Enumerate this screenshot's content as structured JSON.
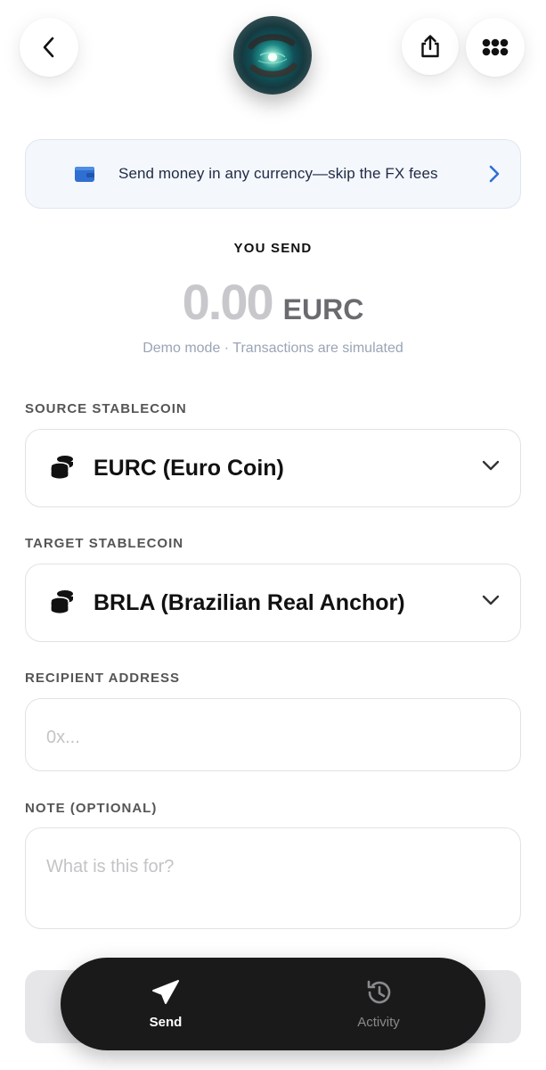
{
  "header": {
    "back_icon": "chevron-left-icon",
    "share_icon": "share-icon",
    "more_icon": "dots-grid-icon"
  },
  "banner": {
    "icon": "wallet-icon",
    "text": "Send money in any currency—skip the FX fees",
    "accent": "#2f6fd1"
  },
  "send": {
    "heading": "YOU SEND",
    "amount": "0.00",
    "currency": "EURC",
    "demo_note": "Demo mode · Transactions are simulated"
  },
  "form": {
    "source_label": "SOURCE STABLECOIN",
    "source_value": "EURC (Euro Coin)",
    "target_label": "TARGET STABLECOIN",
    "target_value": "BRLA (Brazilian Real Anchor)",
    "recipient_label": "RECIPIENT ADDRESS",
    "recipient_placeholder": "0x...",
    "note_label": "NOTE (OPTIONAL)",
    "note_placeholder": "What is this for?"
  },
  "tabbar": {
    "send_label": "Send",
    "activity_label": "Activity"
  }
}
